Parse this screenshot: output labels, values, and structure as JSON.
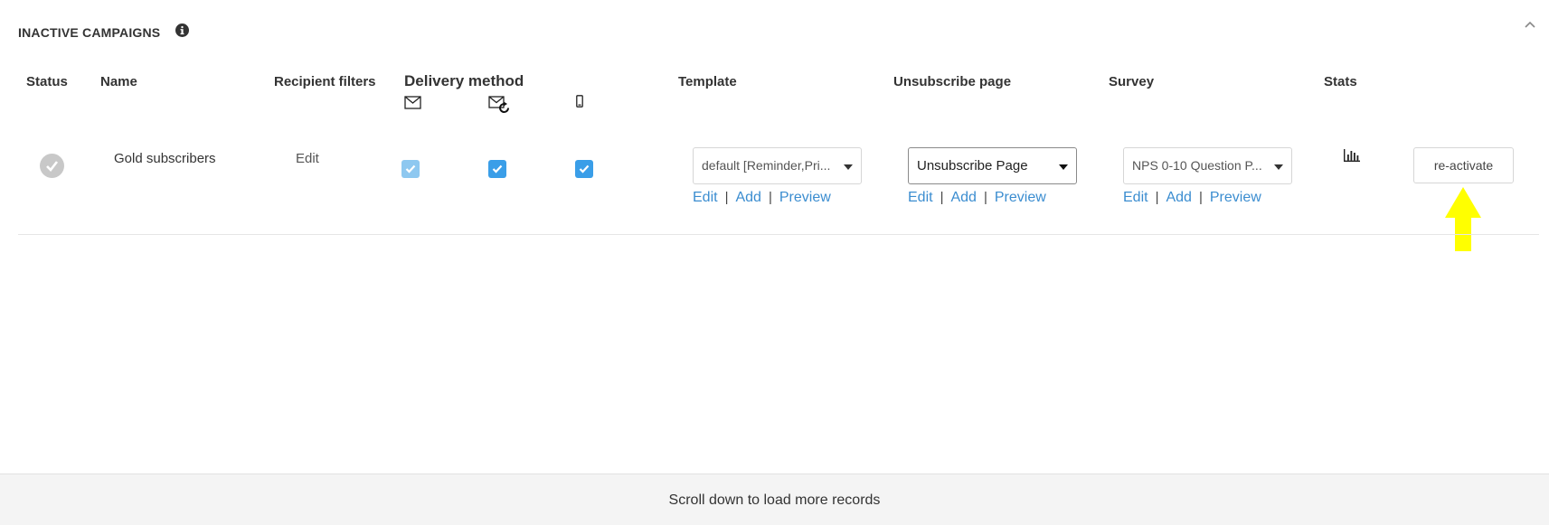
{
  "section": {
    "title": "INACTIVE CAMPAIGNS",
    "info_icon": "info-circle-icon",
    "collapse_icon": "chevron-up-icon"
  },
  "columns": {
    "status": "Status",
    "name": "Name",
    "recipient_filters": "Recipient filters",
    "delivery_method": "Delivery method",
    "delivery_icons": [
      "envelope-icon",
      "envelope-refresh-icon",
      "mobile-phone-icon"
    ],
    "template": "Template",
    "unsubscribe_page": "Unsubscribe page",
    "survey": "Survey",
    "stats": "Stats"
  },
  "rows": [
    {
      "status_icon": "check-circle-icon",
      "name": "Gold subscribers",
      "recipient_filter_edit": "Edit",
      "delivery": {
        "email": true,
        "email_reminder": true,
        "sms": true
      },
      "template": {
        "value": "default [Reminder,Pri...",
        "edit": "Edit",
        "add": "Add",
        "preview": "Preview"
      },
      "unsubscribe": {
        "value": "Unsubscribe Page",
        "edit": "Edit",
        "add": "Add",
        "preview": "Preview"
      },
      "survey": {
        "value": "NPS 0-10 Question P...",
        "edit": "Edit",
        "add": "Add",
        "preview": "Preview"
      },
      "stats_icon": "bar-chart-icon",
      "action": "re-activate"
    }
  ],
  "link_separator": "|",
  "annotation": {
    "icon": "up-arrow-icon",
    "color": "#ffff00"
  },
  "colors": {
    "link": "#3b8dd0",
    "checkbox": "#3a9ee8",
    "checkbox_disabled": "#8ec8f0"
  },
  "footer": {
    "text": "Scroll down to load more records"
  }
}
